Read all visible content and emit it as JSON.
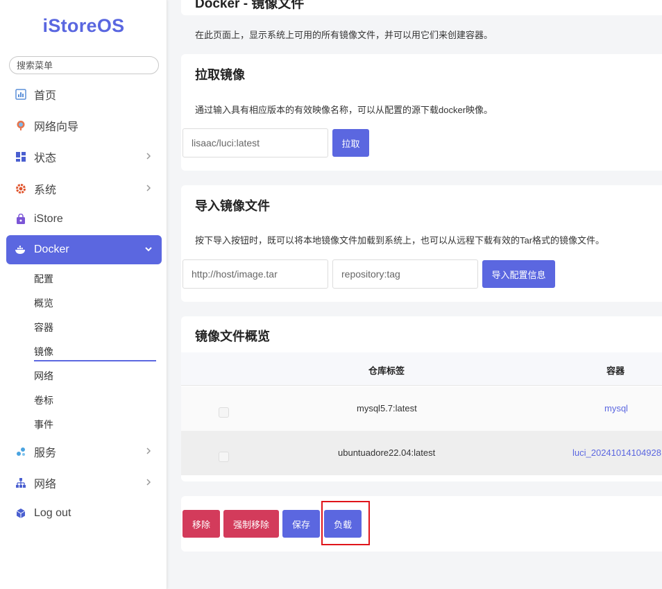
{
  "brand": {
    "logo_text": "iStoreOS"
  },
  "search": {
    "placeholder": "搜索菜单"
  },
  "nav": {
    "home": "首页",
    "network_wizard": "网络向导",
    "status": "状态",
    "system": "系统",
    "istore": "iStore",
    "docker": "Docker",
    "services": "服务",
    "network": "网络",
    "logout": "Log out"
  },
  "docker_sub": {
    "config": "配置",
    "overview": "概览",
    "containers": "容器",
    "images": "镜像",
    "networks": "网络",
    "volumes": "卷标",
    "events": "事件"
  },
  "page": {
    "title": "Docker - 镜像文件",
    "description": "在此页面上，显示系统上可用的所有镜像文件，并可以用它们来创建容器。"
  },
  "pull": {
    "heading": "拉取镜像",
    "description": "通过输入具有相应版本的有效映像名称，可以从配置的源下载docker映像。",
    "input_placeholder": "lisaac/luci:latest",
    "button": "拉取"
  },
  "import": {
    "heading": "导入镜像文件",
    "description": "按下导入按钮时，既可以将本地镜像文件加载到系统上，也可以从远程下载有效的Tar格式的镜像文件。",
    "url_placeholder": "http://host/image.tar",
    "tag_placeholder": "repository:tag",
    "button": "导入配置信息"
  },
  "images_overview": {
    "heading": "镜像文件概览",
    "columns": {
      "repo_tag": "仓库标签",
      "containers": "容器"
    },
    "rows": [
      {
        "repo_tag": "mysql5.7:latest",
        "containers": "mysql"
      },
      {
        "repo_tag": "ubuntuadore22.04:latest",
        "containers": "luci_20241014104928 |"
      }
    ]
  },
  "actions": {
    "remove": "移除",
    "force_remove": "强制移除",
    "save": "保存",
    "load": "负载"
  },
  "colors": {
    "accent": "#5b67e0",
    "danger": "#d33b5b",
    "highlight_box": "#e0141a"
  }
}
